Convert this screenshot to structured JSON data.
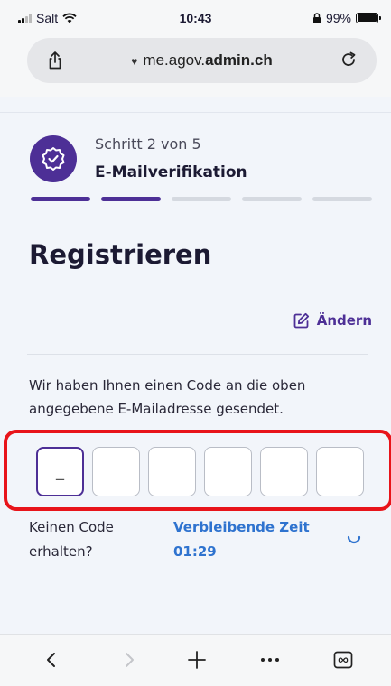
{
  "status_bar": {
    "carrier": "Salt",
    "time": "10:43",
    "battery": "99%",
    "battery_level": 0.99
  },
  "browser": {
    "url_prefix": "me.agov.",
    "url_domain": "admin.ch",
    "icons": [
      "share-icon",
      "lock-icon",
      "reload-icon"
    ]
  },
  "stepper": {
    "count_text": "Schritt 2 von 5",
    "title": "E-Mailverifikation",
    "steps": [
      true,
      true,
      false,
      false,
      false
    ]
  },
  "page": {
    "title": "Registrieren",
    "change_label": "Ändern",
    "info_text": "Wir haben Ihnen einen Code an die oben angegebene E-Mailadresse gesendet.",
    "code_placeholder": "_",
    "no_code_text": "Keinen Code erhalten?",
    "remaining_label": "Verbleibende Zeit",
    "remaining_value": "01:29"
  },
  "toolbar": {
    "icons": [
      "back-icon",
      "forward-icon",
      "new-tab-icon",
      "more-icon",
      "tabs-icon"
    ]
  },
  "colors": {
    "accent": "#4d2f96",
    "link": "#2f73cf",
    "highlight": "#e8141a"
  }
}
